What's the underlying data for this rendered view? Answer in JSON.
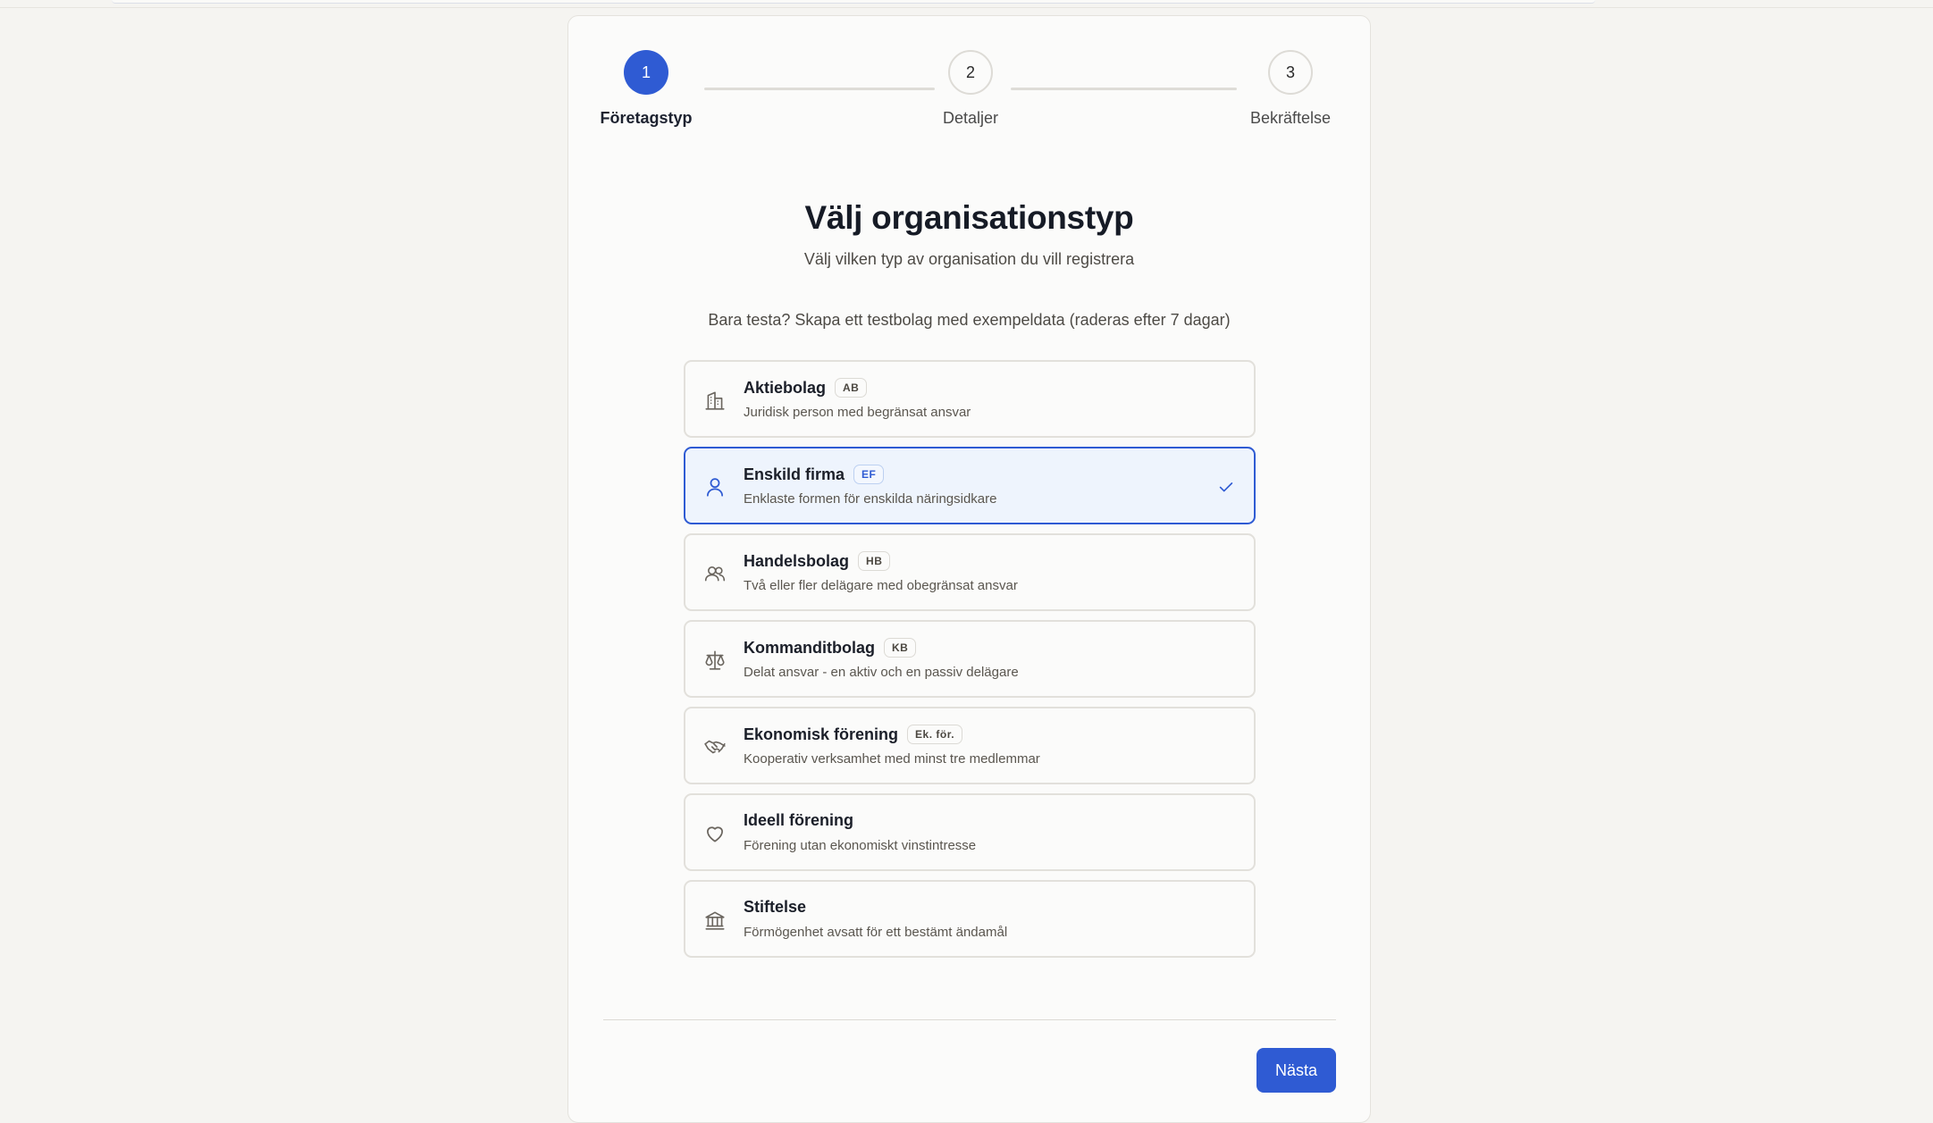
{
  "stepper": {
    "steps": [
      {
        "number": "1",
        "label": "Företagstyp",
        "state": "active"
      },
      {
        "number": "2",
        "label": "Detaljer",
        "state": "todo"
      },
      {
        "number": "3",
        "label": "Bekräftelse",
        "state": "todo"
      }
    ]
  },
  "header": {
    "title": "Välj organisationstyp",
    "subtitle": "Välj vilken typ av organisation du vill registrera"
  },
  "test_link": "Bara testa? Skapa ett testbolag med exempeldata (raderas efter 7 dagar)",
  "options": [
    {
      "name": "Aktiebolag",
      "badge": "AB",
      "desc": "Juridisk person med begränsat ansvar",
      "icon": "building-icon",
      "selected": false
    },
    {
      "name": "Enskild firma",
      "badge": "EF",
      "desc": "Enklaste formen för enskilda näringsidkare",
      "icon": "user-icon",
      "selected": true
    },
    {
      "name": "Handelsbolag",
      "badge": "HB",
      "desc": "Två eller fler delägare med obegränsat ansvar",
      "icon": "users-icon",
      "selected": false
    },
    {
      "name": "Kommanditbolag",
      "badge": "KB",
      "desc": "Delat ansvar - en aktiv och en passiv delägare",
      "icon": "scale-icon",
      "selected": false
    },
    {
      "name": "Ekonomisk förening",
      "badge": "Ek. för.",
      "desc": "Kooperativ verksamhet med minst tre medlemmar",
      "icon": "handshake-icon",
      "selected": false
    },
    {
      "name": "Ideell förening",
      "badge": "",
      "desc": "Förening utan ekonomiskt vinstintresse",
      "icon": "heart-icon",
      "selected": false
    },
    {
      "name": "Stiftelse",
      "badge": "",
      "desc": "Förmögenhet avsatt för ett bestämt ändamål",
      "icon": "landmark-icon",
      "selected": false
    }
  ],
  "footer": {
    "next_label": "Nästa"
  },
  "colors": {
    "accent": "#2f5bd3",
    "selected_bg": "#eef4fd",
    "page_bg": "#f5f4f1"
  }
}
